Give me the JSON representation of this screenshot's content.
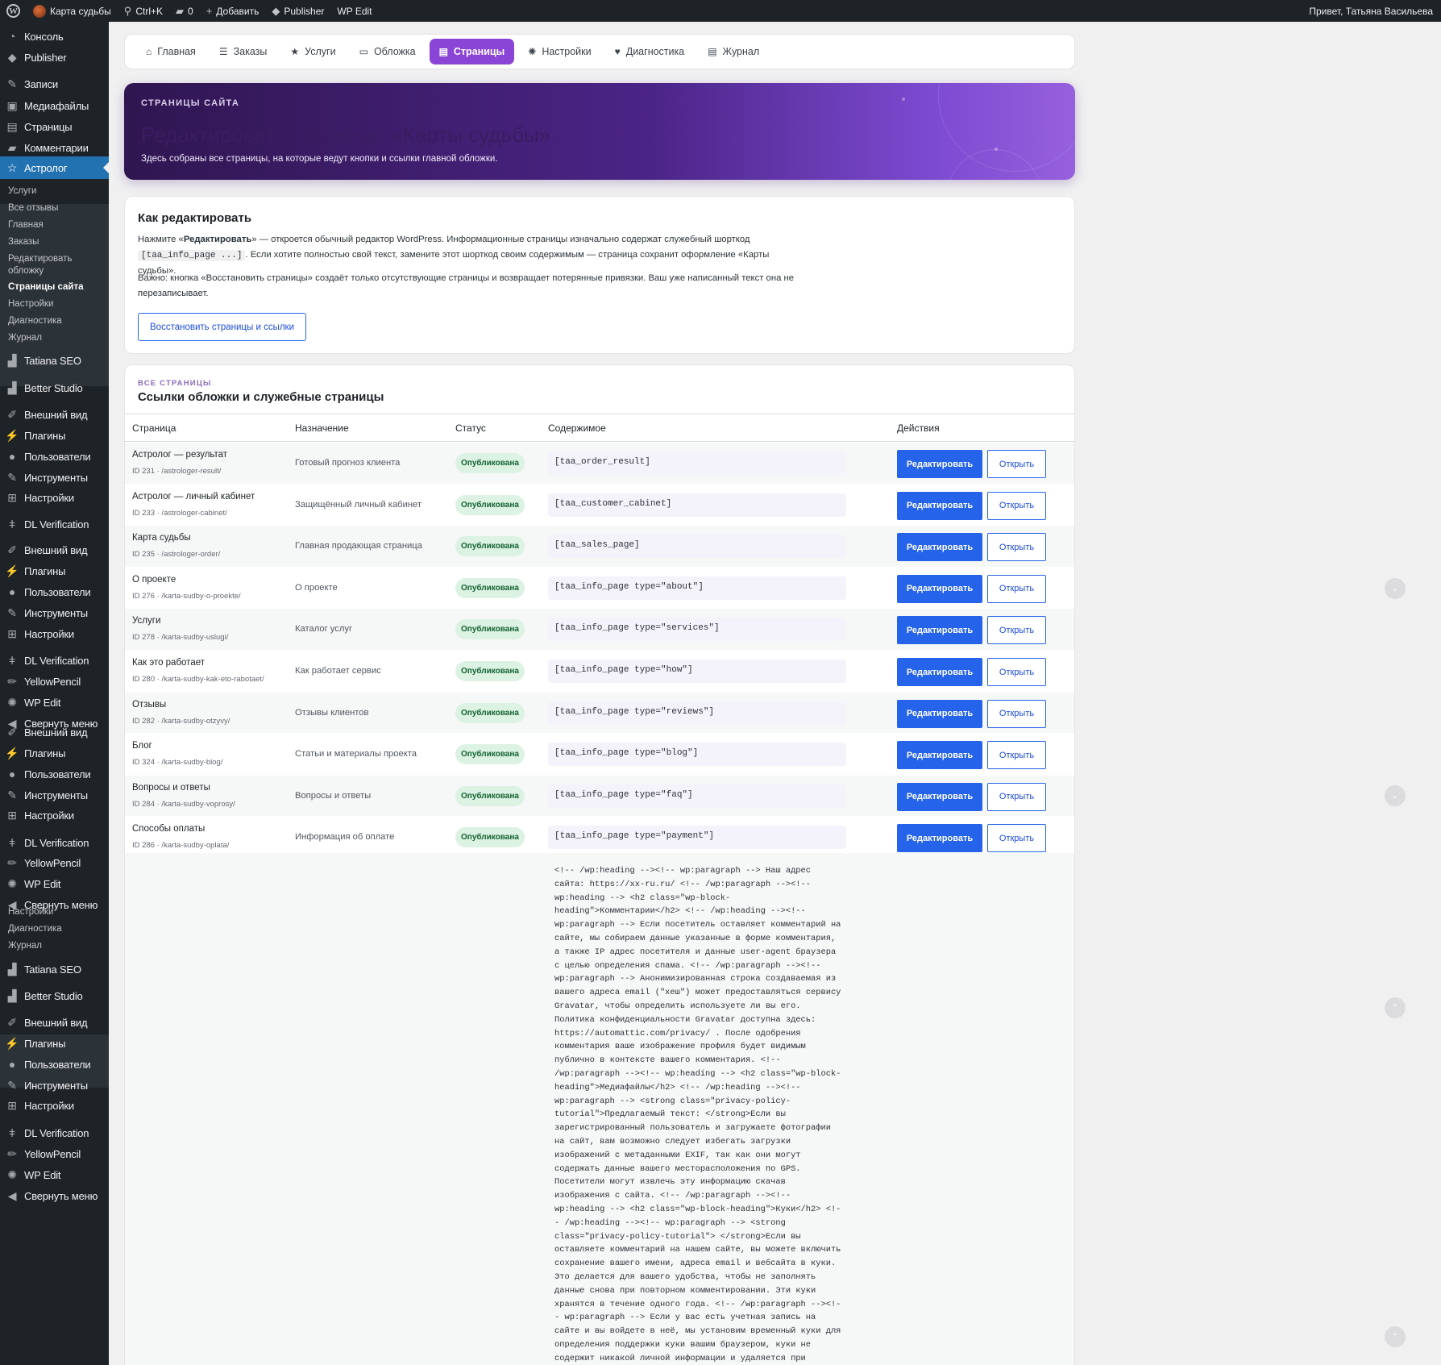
{
  "admin_bar": {
    "wp_logo": "W",
    "site_name": "Карта судьбы",
    "search_shortcut": "Ctrl+K",
    "comments_count": "0",
    "add_new": "Добавить",
    "publisher": "Publisher",
    "wp_edit": "WP Edit",
    "greeting": "Привет, Татьяна Васильева"
  },
  "sidebar": {
    "menu": [
      {
        "label": "Консоль",
        "icon": "dashboard-icon",
        "glyph": "◔"
      },
      {
        "label": "Publisher",
        "icon": "publisher-icon",
        "glyph": "◆"
      },
      {
        "label": "Записи",
        "icon": "pin-icon",
        "glyph": "✎"
      },
      {
        "label": "Медиафайлы",
        "icon": "media-icon",
        "glyph": "▣"
      },
      {
        "label": "Страницы",
        "icon": "pages-icon",
        "glyph": "▤"
      },
      {
        "label": "Комментарии",
        "icon": "comments-icon",
        "glyph": "▰"
      },
      {
        "label": "Астролог",
        "icon": "star-icon",
        "glyph": "☆"
      },
      {
        "label": "Tatiana SEO",
        "icon": "chart-icon",
        "glyph": "▟"
      },
      {
        "label": "Better Studio",
        "icon": "chart-icon",
        "glyph": "▟"
      },
      {
        "label": "Внешний вид",
        "icon": "brush-icon",
        "glyph": "✐"
      },
      {
        "label": "Плагины",
        "icon": "plugin-icon",
        "glyph": "⚡"
      },
      {
        "label": "Пользователи",
        "icon": "users-icon",
        "glyph": "●"
      },
      {
        "label": "Инструменты",
        "icon": "wrench-icon",
        "glyph": "✎"
      },
      {
        "label": "Настройки",
        "icon": "settings-icon",
        "glyph": "⊞"
      },
      {
        "label": "DL Verification",
        "icon": "key-icon",
        "glyph": "ǂ"
      },
      {
        "label": "Внешний вид",
        "icon": "brush-icon",
        "glyph": "✐"
      },
      {
        "label": "Плагины",
        "icon": "plugin-icon",
        "glyph": "⚡"
      },
      {
        "label": "Пользователи",
        "icon": "users-icon",
        "glyph": "●"
      },
      {
        "label": "Инструменты",
        "icon": "wrench-icon",
        "glyph": "✎"
      },
      {
        "label": "Настройки",
        "icon": "settings-icon",
        "glyph": "⊞"
      },
      {
        "label": "DL Verification",
        "icon": "key-icon",
        "glyph": "ǂ"
      },
      {
        "label": "YellowPencil",
        "icon": "pencil-icon",
        "glyph": "✏"
      },
      {
        "label": "WP Edit",
        "icon": "gear-icon",
        "glyph": "✺"
      },
      {
        "label": "Свернуть меню",
        "icon": "collapse-icon",
        "glyph": "◀"
      },
      {
        "label": "Внешний вид",
        "icon": "brush-icon",
        "glyph": "✐"
      },
      {
        "label": "Плагины",
        "icon": "plugin-icon",
        "glyph": "⚡"
      },
      {
        "label": "Пользователи",
        "icon": "users-icon",
        "glyph": "●"
      },
      {
        "label": "Инструменты",
        "icon": "wrench-icon",
        "glyph": "✎"
      },
      {
        "label": "Настройки",
        "icon": "settings-icon",
        "glyph": "⊞"
      },
      {
        "label": "DL Verification",
        "icon": "key-icon",
        "glyph": "ǂ"
      },
      {
        "label": "YellowPencil",
        "icon": "pencil-icon",
        "glyph": "✏"
      },
      {
        "label": "WP Edit",
        "icon": "gear-icon",
        "glyph": "✺"
      },
      {
        "label": "Свернуть меню",
        "icon": "collapse-icon",
        "glyph": "◀"
      },
      {
        "label": "Tatiana SEO",
        "icon": "chart-icon",
        "glyph": "▟"
      },
      {
        "label": "Better Studio",
        "icon": "chart-icon",
        "glyph": "▟"
      },
      {
        "label": "Внешний вид",
        "icon": "brush-icon",
        "glyph": "✐"
      },
      {
        "label": "Плагины",
        "icon": "plugin-icon",
        "glyph": "⚡"
      },
      {
        "label": "Пользователи",
        "icon": "users-icon",
        "glyph": "●"
      },
      {
        "label": "Инструменты",
        "icon": "wrench-icon",
        "glyph": "✎"
      },
      {
        "label": "Настройки",
        "icon": "settings-icon",
        "glyph": "⊞"
      },
      {
        "label": "DL Verification",
        "icon": "key-icon",
        "glyph": "ǂ"
      },
      {
        "label": "YellowPencil",
        "icon": "pencil-icon",
        "glyph": "✏"
      },
      {
        "label": "WP Edit",
        "icon": "gear-icon",
        "glyph": "✺"
      },
      {
        "label": "Свернуть меню",
        "icon": "collapse-icon",
        "glyph": "◀"
      }
    ],
    "submenu": [
      "Услуги",
      "Все отзывы",
      "Главная",
      "Заказы",
      "Редактировать обложку",
      "Страницы сайта",
      "Настройки",
      "Диагностика",
      "Журнал"
    ],
    "submenu_repeat": [
      "Настройки",
      "Диагностика",
      "Журнал"
    ]
  },
  "tabs": [
    {
      "label": "Главная",
      "icon": "home-icon",
      "glyph": "⌂"
    },
    {
      "label": "Заказы",
      "icon": "list-icon",
      "glyph": "☰"
    },
    {
      "label": "Услуги",
      "icon": "star-icon",
      "glyph": "★"
    },
    {
      "label": "Обложка",
      "icon": "cover-icon",
      "glyph": "▭"
    },
    {
      "label": "Страницы",
      "icon": "pages-icon",
      "glyph": "▤"
    },
    {
      "label": "Настройки",
      "icon": "gear-icon",
      "glyph": "✺"
    },
    {
      "label": "Диагностика",
      "icon": "heart-icon",
      "glyph": "♥"
    },
    {
      "label": "Журнал",
      "icon": "doc-icon",
      "glyph": "▤"
    }
  ],
  "hero": {
    "eyebrow": "СТРАНИЦЫ САЙТА",
    "title": "Редактировать страницы «Карты судьбы»",
    "subtitle": "Здесь собраны все страницы, на которые ведут кнопки и ссылки главной обложки."
  },
  "howto": {
    "title": "Как редактировать",
    "p1_a": "Нажмите «",
    "p1_b": "Редактировать",
    "p1_c": "» — откроется обычный редактор WordPress. Информационные страницы изначально содержат служебный шорткод ",
    "p1_code": "[taa_info_page ...]",
    "p1_d": ". Если хотите полностью свой текст, замените этот шорткод своим содержимым — страница сохранит оформление «Карты судьбы».",
    "p2_a": "Важно:",
    "p2_b": " кнопка «Восстановить страницы» создаёт только отсутствующие страницы и возвращает потерянные привязки. Ваш уже написанный текст она не перезаписывает.",
    "restore_button": "Восстановить страницы и ссылки"
  },
  "pages_table": {
    "eyebrow": "ВСЕ СТРАНИЦЫ",
    "title": "Ссылки обложки и служебные страницы",
    "columns": [
      "Страница",
      "Назначение",
      "Статус",
      "Содержимое",
      "Действия"
    ],
    "edit_label": "Редактировать",
    "open_label": "Открыть",
    "rows": [
      {
        "title": "Астролог — результат",
        "meta": "ID 231 · /astrologer-result/",
        "purpose": "Готовый прогноз клиента",
        "status": "Опубликована",
        "content": "[taa_order_result]"
      },
      {
        "title": "Астролог — личный кабинет",
        "meta": "ID 233 · /astrologer-cabinet/",
        "purpose": "Защищённый личный кабинет",
        "status": "Опубликована",
        "content": "[taa_customer_cabinet]"
      },
      {
        "title": "Карта судьбы",
        "meta": "ID 235 · /astrologer-order/",
        "purpose": "Главная продающая страница",
        "status": "Опубликована",
        "content": "[taa_sales_page]"
      },
      {
        "title": "О проекте",
        "meta": "ID 276 · /karta-sudby-o-proekte/",
        "purpose": "О проекте",
        "status": "Опубликована",
        "content": "[taa_info_page type=\"about\"]"
      },
      {
        "title": "Услуги",
        "meta": "ID 278 · /karta-sudby-uslugi/",
        "purpose": "Каталог услуг",
        "status": "Опубликована",
        "content": "[taa_info_page type=\"services\"]"
      },
      {
        "title": "Как это работает",
        "meta": "ID 280 · /karta-sudby-kak-eto-rabotaet/",
        "purpose": "Как работает сервис",
        "status": "Опубликована",
        "content": "[taa_info_page type=\"how\"]"
      },
      {
        "title": "Отзывы",
        "meta": "ID 282 · /karta-sudby-otzyvy/",
        "purpose": "Отзывы клиентов",
        "status": "Опубликована",
        "content": "[taa_info_page type=\"reviews\"]"
      },
      {
        "title": "Блог",
        "meta": "ID 324 · /karta-sudby-blog/",
        "purpose": "Статьи и материалы проекта",
        "status": "Опубликована",
        "content": "[taa_info_page type=\"blog\"]"
      },
      {
        "title": "Вопросы и ответы",
        "meta": "ID 284 · /karta-sudby-voprosy/",
        "purpose": "Вопросы и ответы",
        "status": "Опубликована",
        "content": "[taa_info_page type=\"faq\"]"
      },
      {
        "title": "Способы оплаты",
        "meta": "ID 286 · /karta-sudby-oplata/",
        "purpose": "Информация об оплате",
        "status": "Опубликована",
        "content": "[taa_info_page type=\"payment\"]"
      }
    ],
    "raw_content": "<!-- /wp:heading --><!-- wp:paragraph --> Наш адрес сайта: https://xx-ru.ru/ <!-- /wp:paragraph --><!-- wp:heading --> <h2 class=\"wp-block-heading\">Комментарии</h2> <!-- /wp:heading --><!-- wp:paragraph --> Если посетитель оставляет комментарий на сайте, мы собираем данные указанные в форме комментария, а также IP адрес посетителя и данные user-agent браузера с целью определения спама. <!-- /wp:paragraph --><!-- wp:paragraph --> Анонимизированная строка создаваемая из вашего адреса email (\"хеш\") может предоставляться сервису Gravatar, чтобы определить используете ли вы его. Политика конфиденциальности Gravatar доступна здесь: https://automattic.com/privacy/ . После одобрения комментария ваше изображение профиля будет видимым публично в контексте вашего комментария. <!-- /wp:paragraph --><!-- wp:heading --> <h2 class=\"wp-block-heading\">Медиафайлы</h2> <!-- /wp:heading --><!-- wp:paragraph --> <strong class=\"privacy-policy-tutorial\">Предлагаемый текст: </strong>Если вы зарегистрированный пользователь и загружаете фотографии на сайт, вам возможно следует избегать загрузки изображений с метаданными EXIF, так как они могут содержать данные вашего месторасположения по GPS. Посетители могут извлечь эту информацию скачав изображения с сайта. <!-- /wp:paragraph --><!-- wp:heading --> <h2 class=\"wp-block-heading\">Куки</h2> <!-- /wp:heading --><!-- wp:paragraph --> <strong class=\"privacy-policy-tutorial\"> </strong>Если вы оставляете комментарий на нашем сайте, вы можете включить сохранение вашего имени, адреса email и вебсайта в куки. Это делается для вашего удобства, чтобы не заполнять данные снова при повторном комментировании. Эти куки хранятся в течение одного года. <!-- /wp:paragraph --><!-- wp:paragraph --> Если у вас есть учетная запись на сайте и вы войдете в неё, мы установим временный куки для определения поддержки куки вашим браузером, куки не содержит никакой личной информации и удаляется при закрытии вашего браузера. <!-- /wp:paragraph --><!--"
  },
  "scroll_controls": [
    {
      "icon": "chevron-down-icon",
      "glyph": "⌄"
    },
    {
      "icon": "chevron-down-icon",
      "glyph": "⌄"
    },
    {
      "icon": "chevron-up-icon",
      "glyph": "⌃"
    },
    {
      "icon": "chevron-up-icon",
      "glyph": "⌃"
    }
  ],
  "colors": {
    "accent_purple": "#8b45d6",
    "primary_blue": "#2563eb",
    "admin_dark": "#1d2327",
    "active_menu": "#2271b1",
    "status_green_bg": "#dcf2e3",
    "status_green_text": "#136331"
  }
}
